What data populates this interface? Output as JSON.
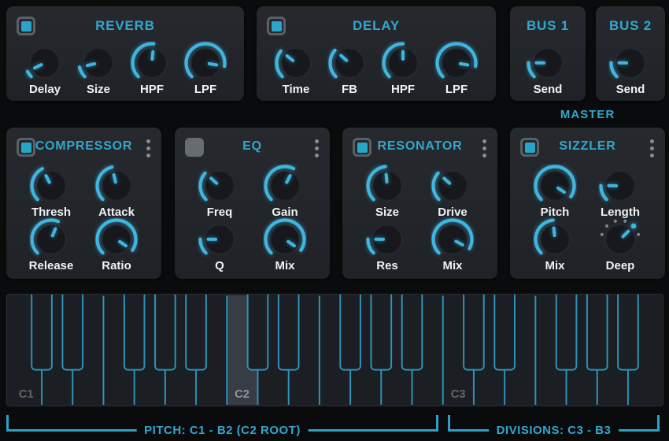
{
  "colors": {
    "accent": "#32a7cd",
    "arc": "#3fb6e0",
    "key_line": "#2e93b9",
    "panel": "#212429",
    "background": "#0a0b0c"
  },
  "send_fx": [
    {
      "title": "REVERB",
      "enabled": true,
      "knobs": [
        {
          "label": "Delay",
          "value": 0.07
        },
        {
          "label": "Size",
          "value": 0.12
        },
        {
          "label": "HPF",
          "value": 0.52
        },
        {
          "label": "LPF",
          "value": 0.87
        }
      ]
    },
    {
      "title": "DELAY",
      "enabled": true,
      "knobs": [
        {
          "label": "Time",
          "value": 0.31
        },
        {
          "label": "FB",
          "value": 0.32
        },
        {
          "label": "HPF",
          "value": 0.5
        },
        {
          "label": "LPF",
          "value": 0.87
        }
      ]
    }
  ],
  "buses": [
    {
      "title": "BUS 1",
      "knobs": [
        {
          "label": "Send",
          "value": 0.17
        }
      ]
    },
    {
      "title": "BUS 2",
      "knobs": [
        {
          "label": "Send",
          "value": 0.17
        }
      ]
    }
  ],
  "master_label": "MASTER",
  "inserts": [
    {
      "title": "COMPRESSOR",
      "enabled": true,
      "knobs": [
        {
          "label": "Thresh",
          "value": 0.4
        },
        {
          "label": "Attack",
          "value": 0.45
        },
        {
          "label": "Release",
          "value": 0.58
        },
        {
          "label": "Ratio",
          "value": 0.96
        }
      ]
    },
    {
      "title": "EQ",
      "enabled": false,
      "knobs": [
        {
          "label": "Freq",
          "value": 0.32
        },
        {
          "label": "Gain",
          "value": 0.6
        },
        {
          "label": "Q",
          "value": 0.17
        },
        {
          "label": "Mix",
          "value": 0.96
        }
      ]
    },
    {
      "title": "RESONATOR",
      "enabled": true,
      "knobs": [
        {
          "label": "Size",
          "value": 0.48
        },
        {
          "label": "Drive",
          "value": 0.32
        },
        {
          "label": "Res",
          "value": 0.17
        },
        {
          "label": "Mix",
          "value": 0.94
        }
      ]
    },
    {
      "title": "SIZZLER",
      "enabled": true,
      "knobs": [
        {
          "label": "Pitch",
          "value": 0.96
        },
        {
          "label": "Length",
          "value": 0.17
        },
        {
          "label": "Mix",
          "value": 0.48
        },
        {
          "label": "Deep",
          "value": 0.8,
          "stepped": true,
          "steps": 6,
          "selected": 4
        }
      ]
    }
  ],
  "keyboard": {
    "octaves": 3,
    "octave_labels": [
      "C1",
      "C2",
      "C3"
    ],
    "highlighted_key": "C2",
    "highlight_white_index": 7
  },
  "footer": {
    "pitch_range_label": "PITCH: C1 - B2 (C2 ROOT)",
    "divisions_range_label": "DIVISIONS: C3 - B3"
  }
}
